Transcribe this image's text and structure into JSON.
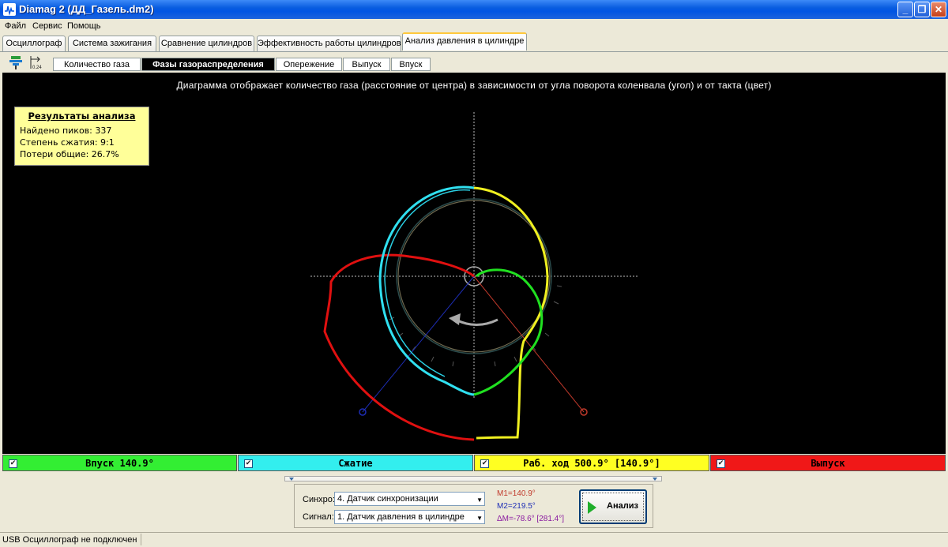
{
  "window": {
    "title": "Diamag 2 (ДД_Газель.dm2)"
  },
  "menu": [
    "Файл",
    "Сервис",
    "Помощь"
  ],
  "tabs": [
    "Осциллограф",
    "Система зажигания",
    "Сравнение цилиндров",
    "Эффективность работы цилиндров",
    "Анализ давления в цилиндре"
  ],
  "subtabs": [
    "Количество газа",
    "Фазы газораспределения",
    "Опережение",
    "Выпуск",
    "Впуск"
  ],
  "toolbar": {
    "icon2_text": "0.24"
  },
  "plot": {
    "caption": "Диаграмма отображает количество газа (расстояние от центра) в зависимости от угла поворота коленвала (угол) и от такта (цвет)",
    "background": "#000000"
  },
  "results": {
    "title": "Результаты анализа",
    "peaks": "Найдено пиков: 337",
    "compression": "Степень сжатия: 9:1",
    "losses": "Потери общие: 26.7%"
  },
  "phases": [
    {
      "label": "Впуск 140.9°",
      "color": "#00ff00"
    },
    {
      "label": "Сжатие",
      "color": "#00ffff"
    },
    {
      "label": "Раб. ход 500.9° [140.9°]",
      "color": "#ffff00"
    },
    {
      "label": "Выпуск",
      "color": "#ff0000"
    }
  ],
  "controls": {
    "sync_label": "Синхро:",
    "sync_value": "4.  Датчик синхронизации",
    "signal_label": "Сигнал:",
    "signal_value": "1.  Датчик давления в цилиндре",
    "m1": "M1=140.9°",
    "m2": "M2=219.5°",
    "dm": "ΔM=-78.6° [281.4°]",
    "analyze_button": "Анализ"
  },
  "status": {
    "text": "USB Осциллограф не подключен"
  }
}
